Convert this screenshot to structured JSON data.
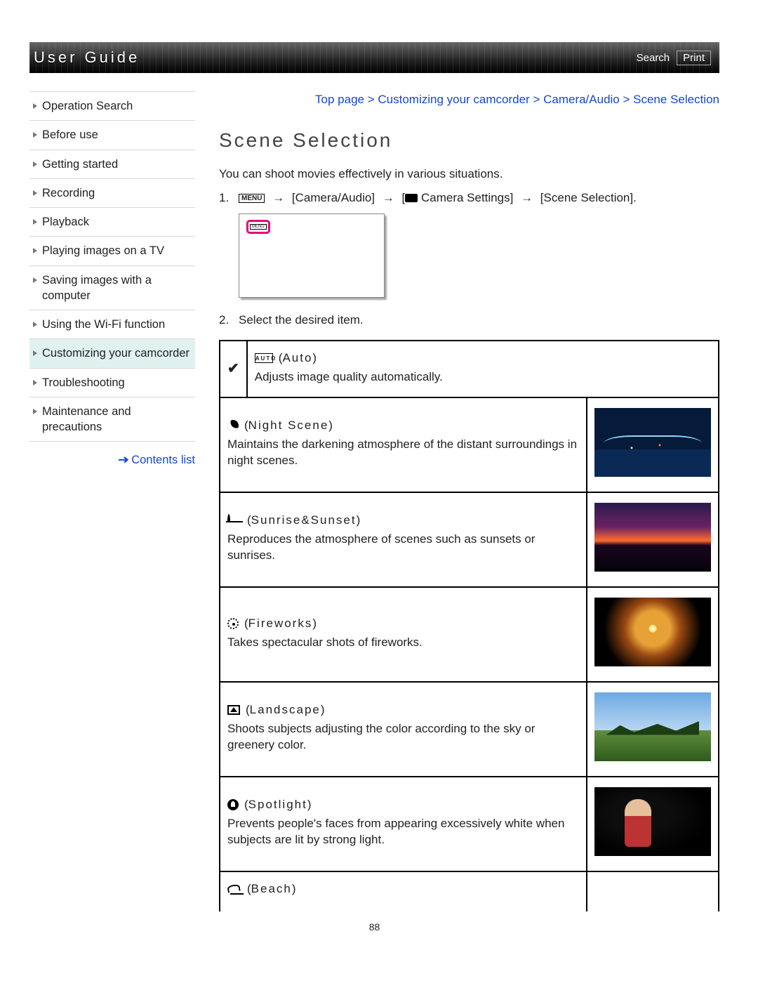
{
  "header": {
    "title": "User Guide",
    "search_label": "Search",
    "print_label": "Print"
  },
  "sidebar": {
    "items": [
      "Operation Search",
      "Before use",
      "Getting started",
      "Recording",
      "Playback",
      "Playing images on a TV",
      "Saving images with a computer",
      "Using the Wi-Fi function",
      "Customizing your camcorder",
      "Troubleshooting",
      "Maintenance and precautions"
    ],
    "active_index": 8,
    "contents_list_label": "Contents list"
  },
  "breadcrumb": "Top page > Customizing your camcorder > Camera/Audio > Scene Selection",
  "page_title": "Scene Selection",
  "intro": "You can shoot movies effectively in various situations.",
  "step1": {
    "num": "1.",
    "menu_badge": "MENU",
    "path1": "[Camera/Audio]",
    "path2_prefix": "[",
    "path2_label": "Camera Settings]",
    "path3": "[Scene Selection]."
  },
  "step2": {
    "num": "2.",
    "text": "Select the desired item."
  },
  "scenes": [
    {
      "icon": "auto",
      "name": "Auto",
      "desc": "Adjusts image quality automatically.",
      "default": true,
      "thumb": null
    },
    {
      "icon": "night",
      "name": "Night Scene",
      "desc": "Maintains the darkening atmosphere of the distant surroundings in night scenes.",
      "default": false,
      "thumb": "night"
    },
    {
      "icon": "sunset",
      "name": "Sunrise&Sunset",
      "desc": "Reproduces the atmosphere of scenes such as sunsets or sunrises.",
      "default": false,
      "thumb": "sunset"
    },
    {
      "icon": "fireworks",
      "name": "Fireworks",
      "desc": "Takes spectacular shots of fireworks.",
      "default": false,
      "thumb": "fireworks"
    },
    {
      "icon": "landscape",
      "name": "Landscape",
      "desc": "Shoots subjects adjusting the color according to the sky or greenery color.",
      "default": false,
      "thumb": "landscape"
    },
    {
      "icon": "spotlight",
      "name": "Spotlight",
      "desc": "Prevents people's faces from appearing excessively white when subjects are lit by strong light.",
      "default": false,
      "thumb": "spotlight"
    },
    {
      "icon": "beach",
      "name": "Beach",
      "desc": "",
      "default": false,
      "thumb": null
    }
  ],
  "page_number": "88"
}
